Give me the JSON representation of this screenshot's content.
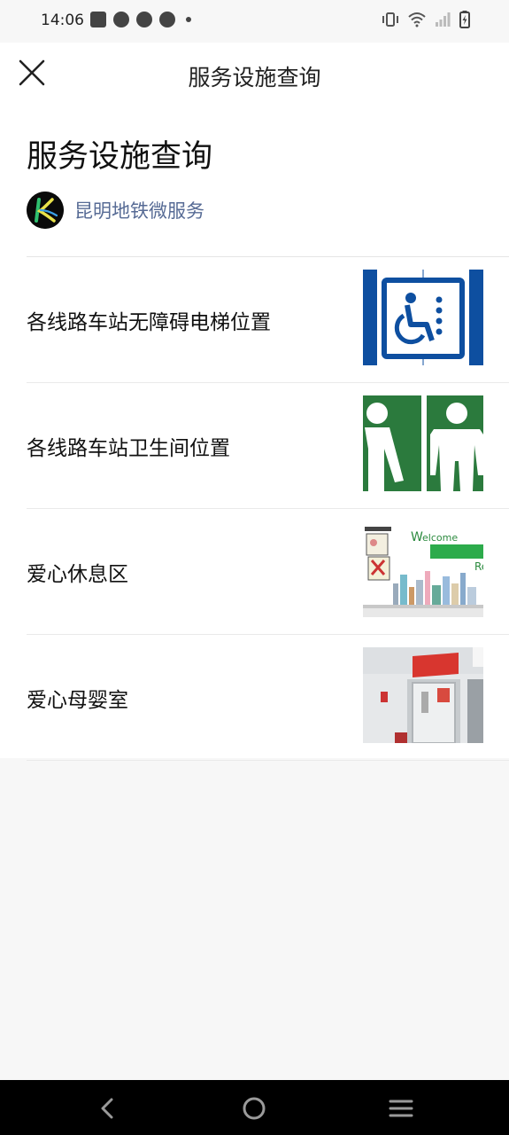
{
  "status_bar": {
    "time": "14:06",
    "left_icons": [
      "notification-icon",
      "app-icon",
      "app-icon",
      "app-icon",
      "more-dot-icon"
    ],
    "right_icons": [
      "vibrate-icon",
      "wifi-icon",
      "signal-icon",
      "battery-charging-icon"
    ]
  },
  "nav": {
    "title": "服务设施查询",
    "close_icon": "close-icon"
  },
  "article": {
    "title": "服务设施查询",
    "account": "昆明地铁微服务"
  },
  "items": [
    {
      "label": "各线路车站无障碍电梯位置",
      "thumb": "accessible-elevator-image"
    },
    {
      "label": "各线路车站卫生间位置",
      "thumb": "restroom-sign-image"
    },
    {
      "label": "爱心休息区",
      "thumb": "rest-area-poster-image"
    },
    {
      "label": "爱心母婴室",
      "thumb": "nursing-room-photo-image"
    }
  ],
  "system_nav": [
    "back-icon",
    "home-icon",
    "recents-icon"
  ],
  "colors": {
    "link": "#576b95",
    "elevator_blue": "#0e4fa0",
    "restroom_green": "#2b7a3d"
  }
}
